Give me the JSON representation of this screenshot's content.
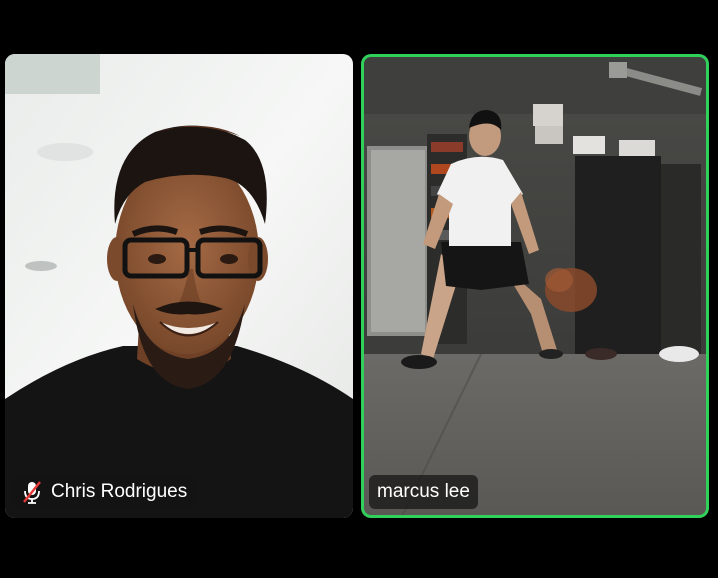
{
  "participants": [
    {
      "name": "Chris Rodrigues",
      "muted": true,
      "active_speaker": false,
      "mic_icon": "mic-off-icon"
    },
    {
      "name": "marcus lee",
      "muted": false,
      "active_speaker": true
    }
  ],
  "colors": {
    "active_speaker_border": "#2fd15a",
    "mute_icon_red": "#e53935",
    "background": "#000000"
  }
}
